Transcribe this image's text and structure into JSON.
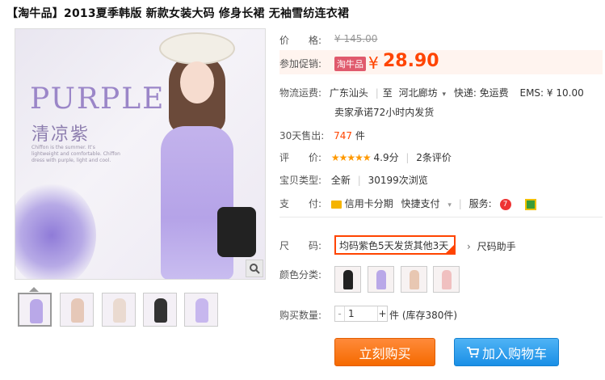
{
  "title": "【淘牛品】2013夏季韩版 新款女装大码 修身长裙 无袖雪纺连衣裙",
  "image": {
    "text_large": "PURPLE",
    "text_cn": "清凉紫",
    "text_small": "Chiffon is the summer. It’s lightweight and comfortable. Chiffon dress with purple, light and cool."
  },
  "price": {
    "label": "价　　格:",
    "original": "¥ 145.00"
  },
  "promo": {
    "label": "参加促销:",
    "badge": "淘牛品",
    "currency": "¥",
    "price": "28.90"
  },
  "shipping": {
    "label": "物流运费:",
    "from": "广东汕头",
    "to_prefix": "至",
    "to": "河北廊坊",
    "express": "快递: 免运费",
    "ems": "EMS: ¥ 10.00",
    "promise": "卖家承诺72小时内发货"
  },
  "sales": {
    "label": "30天售出:",
    "count": "747",
    "unit": "件"
  },
  "rating": {
    "label": "评　　价:",
    "stars": "★★★★★",
    "score": "4.9分",
    "reviews": "2条评价"
  },
  "baby_type": {
    "label": "宝贝类型:",
    "type": "全新",
    "views": "30199次浏览"
  },
  "payment": {
    "label": "支　　付:",
    "credit": "信用卡分期",
    "quick": "快捷支付",
    "service_label": "服务:"
  },
  "size": {
    "label": "尺　　码:",
    "value": "均码紫色5天发货其他3天",
    "helper": "尺码助手"
  },
  "color": {
    "label": "颜色分类:"
  },
  "quantity": {
    "label": "购买数量:",
    "minus": "-",
    "value": "1",
    "plus": "+",
    "stock": "件 (库存380件)"
  },
  "buttons": {
    "buy": "立刻购买",
    "cart": "加入购物车"
  },
  "colors": {
    "accent": "#ff4400",
    "buy": "#f56a00",
    "cart": "#1a8fe6",
    "star": "#ff9900"
  }
}
